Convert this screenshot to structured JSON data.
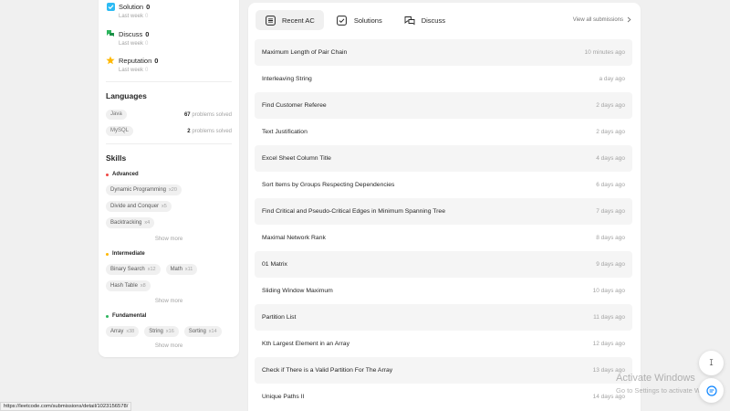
{
  "stats": [
    {
      "label": "Solution",
      "count": "0",
      "sub": "Last week",
      "sub_value": "0",
      "icon": "solution-icon",
      "color": "#2cbbf4"
    },
    {
      "label": "Discuss",
      "count": "0",
      "sub": "Last week",
      "sub_value": "0",
      "icon": "discuss-icon",
      "color": "#2cb55d"
    },
    {
      "label": "Reputation",
      "count": "0",
      "sub": "Last week",
      "sub_value": "0",
      "icon": "star-icon",
      "color": "#ffb800"
    }
  ],
  "languages": {
    "title": "Languages",
    "items": [
      {
        "name": "Java",
        "count": "67",
        "suffix": "problems solved"
      },
      {
        "name": "MySQL",
        "count": "2",
        "suffix": "problems solved"
      }
    ]
  },
  "skills": {
    "title": "Skills",
    "show_more": "Show more",
    "groups": [
      {
        "name": "Advanced",
        "color": "#ef4743",
        "rows": [
          [
            {
              "name": "Dynamic Programming",
              "count": "x20"
            }
          ],
          [
            {
              "name": "Divide and Conquer",
              "count": "x5"
            }
          ],
          [
            {
              "name": "Backtracking",
              "count": "x4"
            }
          ]
        ]
      },
      {
        "name": "Intermediate",
        "color": "#ffb800",
        "rows": [
          [
            {
              "name": "Binary Search",
              "count": "x12"
            },
            {
              "name": "Math",
              "count": "x11"
            }
          ],
          [
            {
              "name": "Hash Table",
              "count": "x8"
            }
          ]
        ]
      },
      {
        "name": "Fundamental",
        "color": "#2cb55d",
        "rows": [
          [
            {
              "name": "Array",
              "count": "x38"
            },
            {
              "name": "String",
              "count": "x16"
            },
            {
              "name": "Sorting",
              "count": "x14"
            }
          ]
        ]
      }
    ]
  },
  "tabs": [
    {
      "label": "Recent AC",
      "icon": "list-icon",
      "active": true
    },
    {
      "label": "Solutions",
      "icon": "checkbox-icon",
      "active": false
    },
    {
      "label": "Discuss",
      "icon": "chat-icon",
      "active": false
    }
  ],
  "view_all": "View all submissions",
  "submissions": [
    {
      "title": "Maximum Length of Pair Chain",
      "time": "10 minutes ago"
    },
    {
      "title": "Interleaving String",
      "time": "a day ago"
    },
    {
      "title": "Find Customer Referee",
      "time": "2 days ago"
    },
    {
      "title": "Text Justification",
      "time": "2 days ago"
    },
    {
      "title": "Excel Sheet Column Title",
      "time": "4 days ago"
    },
    {
      "title": "Sort Items by Groups Respecting Dependencies",
      "time": "6 days ago"
    },
    {
      "title": "Find Critical and Pseudo-Critical Edges in Minimum Spanning Tree",
      "time": "7 days ago"
    },
    {
      "title": "Maximal Network Rank",
      "time": "8 days ago"
    },
    {
      "title": "01 Matrix",
      "time": "9 days ago"
    },
    {
      "title": "Sliding Window Maximum",
      "time": "10 days ago"
    },
    {
      "title": "Partition List",
      "time": "11 days ago"
    },
    {
      "title": "Kth Largest Element in an Array",
      "time": "12 days ago"
    },
    {
      "title": "Check if There is a Valid Partition For The Array",
      "time": "13 days ago"
    },
    {
      "title": "Unique Paths II",
      "time": "14 days ago"
    }
  ],
  "status_url": "https://leetcode.com/submissions/detail/1023156578/",
  "watermark": {
    "line1": "Activate Windows",
    "line2": "Go to Settings to activate Windows."
  },
  "float_buttons": [
    {
      "label": "ꕯ"
    },
    {
      "label": ""
    }
  ]
}
